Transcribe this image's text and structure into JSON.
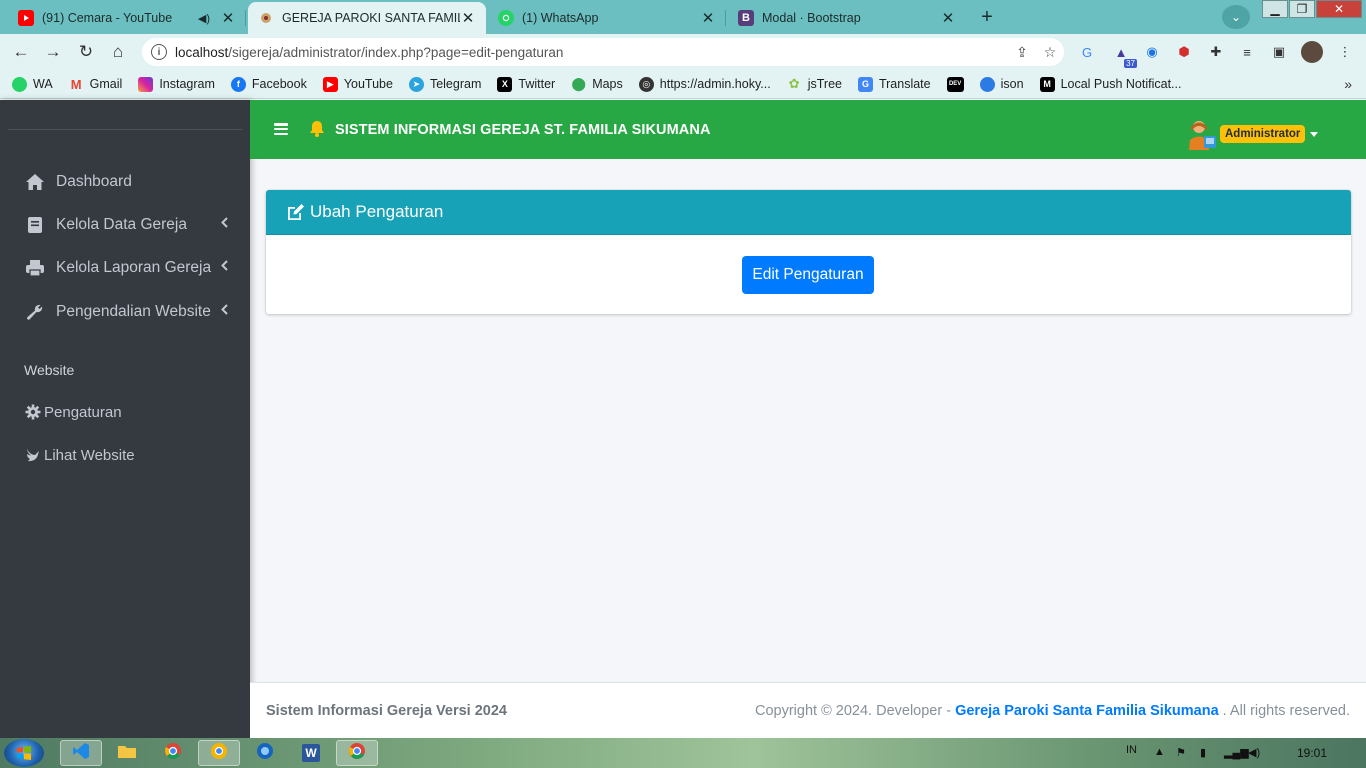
{
  "browser": {
    "tabs": [
      {
        "title": "(91) Cemara - YouTube",
        "icon": "youtube-icon"
      },
      {
        "title": "GEREJA PAROKI SANTA FAMILIA",
        "icon": "site-icon"
      },
      {
        "title": "(1) WhatsApp",
        "icon": "whatsapp-icon"
      },
      {
        "title": "Modal · Bootstrap",
        "icon": "bootstrap-icon"
      }
    ],
    "url_host": "localhost",
    "url_path": "/sigereja/administrator/index.php?page=edit-pengaturan",
    "extension_badge": "37",
    "bookmarks": [
      "WA",
      "Gmail",
      "Instagram",
      "Facebook",
      "YouTube",
      "Telegram",
      "Twitter",
      "Maps",
      "https://admin.hoky...",
      "jsTree",
      "Translate",
      "ison",
      "Local Push Notificat..."
    ],
    "bookmark_icon_text": {
      "dev": "DEV",
      "medium": "M"
    }
  },
  "sidebar": {
    "items": [
      {
        "label": "Dashboard",
        "icon": "home-icon"
      },
      {
        "label": "Kelola Data Gereja",
        "icon": "book-icon"
      },
      {
        "label": "Kelola Laporan Gereja",
        "icon": "printer-icon"
      },
      {
        "label": "Pengendalian Website",
        "icon": "wrench-icon"
      }
    ],
    "section_header": "Website",
    "sub_items": [
      {
        "label": "Pengaturan",
        "icon": "gear-icon"
      },
      {
        "label": "Lihat Website",
        "icon": "dove-icon"
      }
    ]
  },
  "header": {
    "brand": "SISTEM INFORMASI GEREJA ST. FAMILIA SIKUMANA",
    "user": "Administrator"
  },
  "card": {
    "title": "Ubah Pengaturan",
    "button": "Edit Pengaturan"
  },
  "footer": {
    "left": "Sistem Informasi Gereja Versi 2024",
    "copyright_prefix": "Copyright © 2024. Developer -",
    "copyright_link": "Gereja Paroki Santa Familia Sikumana",
    "copyright_suffix": ". All rights reserved."
  },
  "taskbar": {
    "language": "IN",
    "clock": "19:01",
    "word_icon_text": "W"
  },
  "colors": {
    "header_green": "#28a745",
    "sidebar_dark": "#343a40",
    "card_header_teal": "#17a2b8",
    "button_blue": "#007bff",
    "badge_yellow": "#ffc107"
  }
}
